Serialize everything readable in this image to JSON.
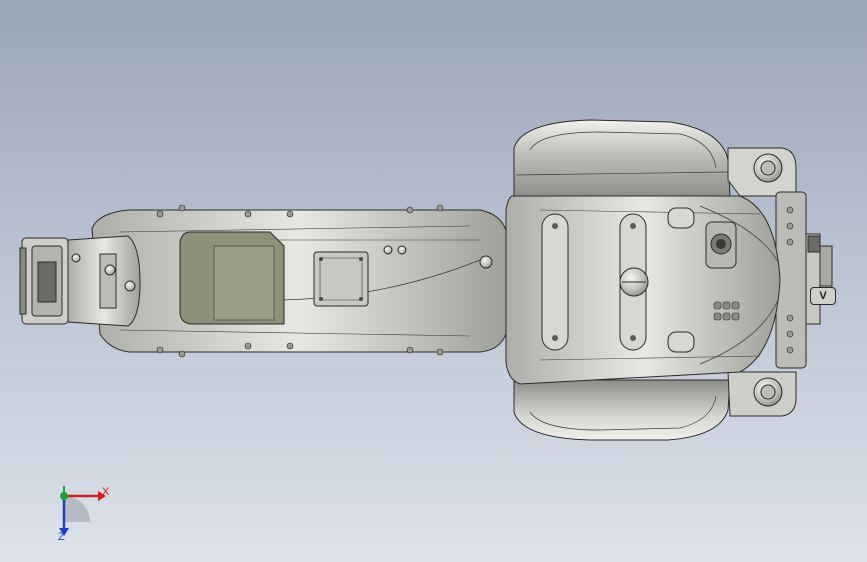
{
  "viewport": {
    "background_top": "#9aa5b7",
    "background_bottom": "#dde2ea"
  },
  "model": {
    "body_color": "#c9c9c3",
    "shadow_color": "#8e8e88",
    "highlight_color": "#f2f2ee",
    "edge_color": "#2a2a2a",
    "dark_part_color": "#5a5a56"
  },
  "badge": {
    "text": "V"
  },
  "triad": {
    "x_label": "X",
    "z_label": "Z",
    "x_color": "#d02020",
    "y_color": "#20a030",
    "z_color": "#2040c0"
  }
}
